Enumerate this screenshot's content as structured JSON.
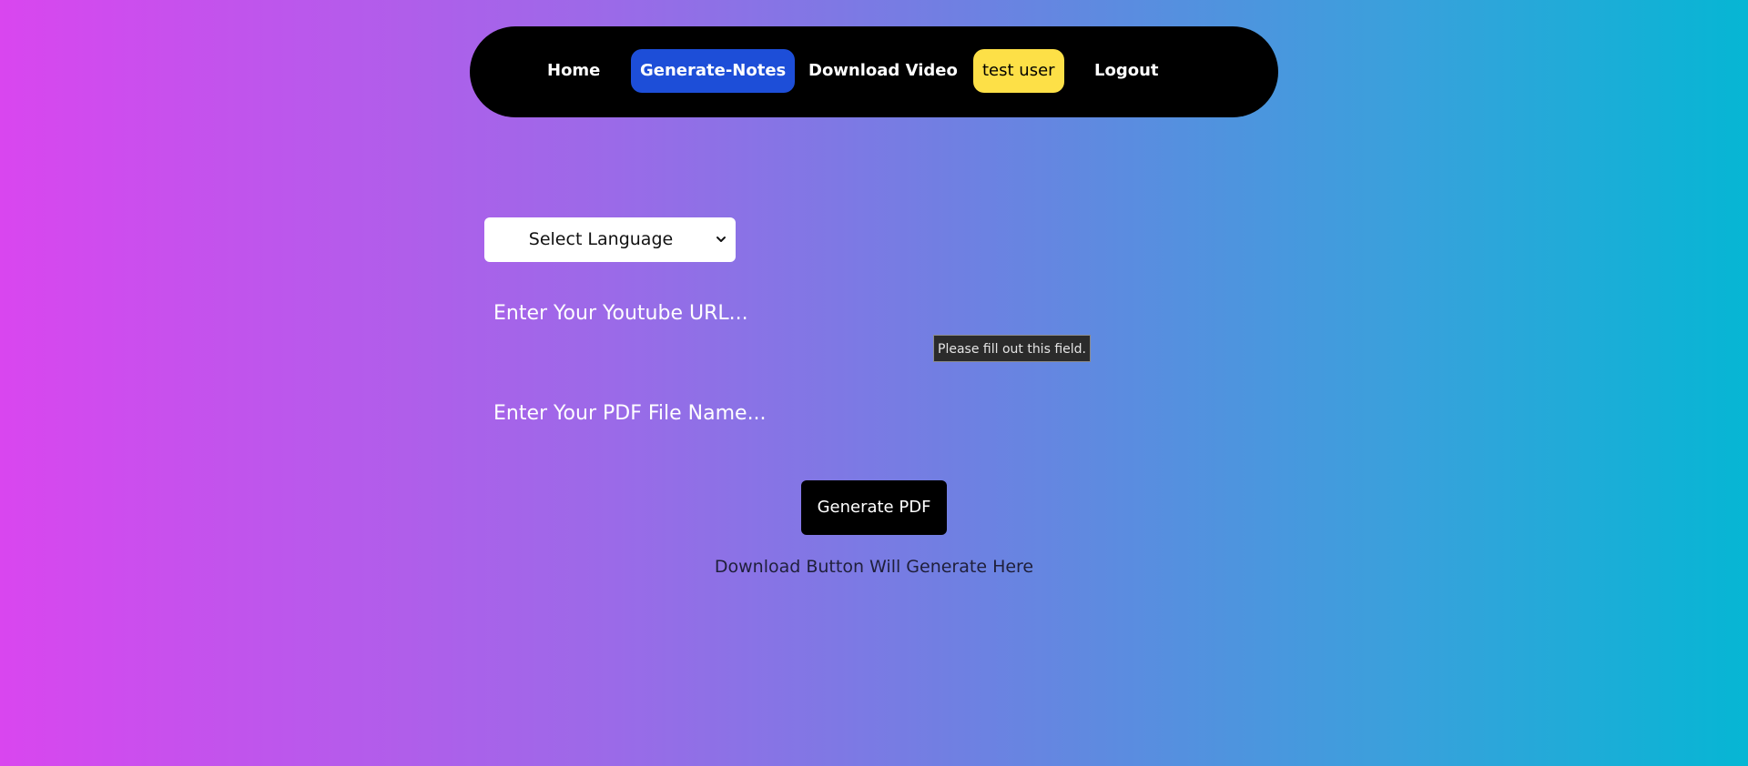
{
  "nav": {
    "home": "Home",
    "generate_notes": "Generate-Notes",
    "download_video": "Download Video",
    "user": "test user",
    "logout": "Logout"
  },
  "form": {
    "language_select": "Select Language",
    "url_placeholder": "Enter Your Youtube URL...",
    "pdf_placeholder": "Enter Your PDF File Name...",
    "validation_tooltip": "Please fill out this field.",
    "generate_button": "Generate PDF",
    "download_note": "Download Button Will Generate Here"
  },
  "colors": {
    "gradient_start": "#d946ef",
    "gradient_end": "#06b6d4",
    "nav_background": "#000000",
    "active_nav": "#1d4ed8",
    "user_badge": "#fde047"
  },
  "icons": {
    "select_arrow": "chevron-down-icon"
  }
}
